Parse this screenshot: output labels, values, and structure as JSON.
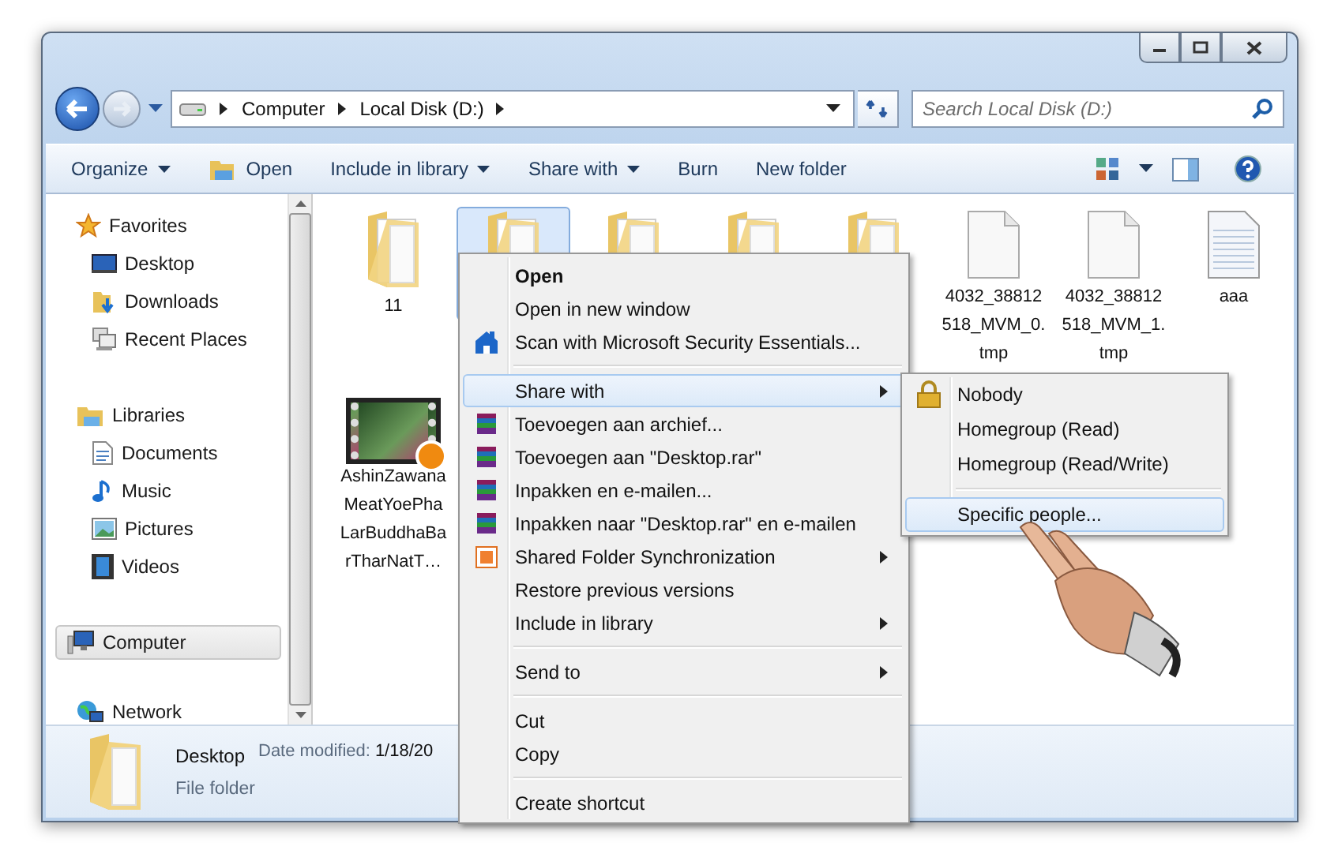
{
  "address": {
    "crumbs": [
      "Computer",
      "Local Disk (D:)"
    ]
  },
  "search": {
    "placeholder": "Search Local Disk (D:)"
  },
  "toolbar": {
    "buttons": [
      {
        "label": "Organize",
        "kind": "plain",
        "dropdown": true
      },
      {
        "label": "Open",
        "kind": "open",
        "dropdown": false
      },
      {
        "label": "Include in library",
        "kind": "plain",
        "dropdown": true
      },
      {
        "label": "Share with",
        "kind": "plain",
        "dropdown": true
      },
      {
        "label": "Burn",
        "kind": "plain",
        "dropdown": false
      },
      {
        "label": "New folder",
        "kind": "plain",
        "dropdown": false
      }
    ]
  },
  "navigation": [
    {
      "label": "Favorites",
      "kind": "favorites",
      "selected": false,
      "children": [
        {
          "label": "Desktop",
          "kind": "desktop",
          "selected": false
        },
        {
          "label": "Downloads",
          "kind": "downloads",
          "selected": false
        },
        {
          "label": "Recent Places",
          "kind": "recent",
          "selected": false
        }
      ]
    },
    {
      "label": "Libraries",
      "kind": "libraries",
      "selected": false,
      "children": [
        {
          "label": "Documents",
          "kind": "documents",
          "selected": false
        },
        {
          "label": "Music",
          "kind": "music",
          "selected": false
        },
        {
          "label": "Pictures",
          "kind": "pictures",
          "selected": false
        },
        {
          "label": "Videos",
          "kind": "videos",
          "selected": false
        }
      ]
    },
    {
      "label": "Computer",
      "kind": "computer",
      "selected": true
    },
    {
      "label": "Network",
      "kind": "network",
      "selected": false
    }
  ],
  "files": [
    {
      "kind": "folder",
      "selected": false,
      "name_lines": [
        "11"
      ]
    },
    {
      "kind": "folder",
      "selected": true
    },
    {
      "kind": "folder",
      "selected": false
    },
    {
      "kind": "folder",
      "selected": false
    },
    {
      "kind": "folder",
      "selected": false
    },
    {
      "kind": "file",
      "selected": false,
      "name_lines": [
        "4032_38812",
        "518_MVM_0.",
        "tmp"
      ]
    },
    {
      "kind": "file",
      "selected": false,
      "name_lines": [
        "4032_38812",
        "518_MVM_1.",
        "tmp"
      ]
    },
    {
      "kind": "text",
      "selected": false,
      "name_lines": [
        "aaa"
      ]
    },
    {
      "kind": "video",
      "selected": false,
      "name_lines": [
        "AshinZawana",
        "MeatYoePha",
        "LarBuddhaBa",
        "rTharNatT…"
      ]
    }
  ],
  "details": {
    "name": "Desktop",
    "type": "File folder",
    "date_label": "Date modified:",
    "date_value": "1/18/20"
  },
  "context_menu": {
    "items": [
      {
        "kind": "plain",
        "label": "Open",
        "default": true,
        "selected": false,
        "submenu": false
      },
      {
        "kind": "plain",
        "label": "Open in new window",
        "default": false,
        "selected": false,
        "submenu": false
      },
      {
        "kind": "security",
        "label": "Scan with Microsoft Security Essentials...",
        "default": false,
        "selected": false,
        "submenu": false
      },
      {
        "kind": "separator"
      },
      {
        "kind": "plain",
        "label": "Share with",
        "default": false,
        "selected": true,
        "submenu": true
      },
      {
        "kind": "archive",
        "label": "Toevoegen aan archief...",
        "default": false,
        "selected": false,
        "submenu": false
      },
      {
        "kind": "archive",
        "label": "Toevoegen aan \"Desktop.rar\"",
        "default": false,
        "selected": false,
        "submenu": false
      },
      {
        "kind": "archive",
        "label": "Inpakken en e-mailen...",
        "default": false,
        "selected": false,
        "submenu": false
      },
      {
        "kind": "archive",
        "label": "Inpakken naar \"Desktop.rar\" en e-mailen",
        "default": false,
        "selected": false,
        "submenu": false
      },
      {
        "kind": "sync",
        "label": "Shared Folder Synchronization",
        "default": false,
        "selected": false,
        "submenu": true
      },
      {
        "kind": "plain",
        "label": "Restore previous versions",
        "default": false,
        "selected": false,
        "submenu": false
      },
      {
        "kind": "plain",
        "label": "Include in library",
        "default": false,
        "selected": false,
        "submenu": true
      },
      {
        "kind": "separator"
      },
      {
        "kind": "plain",
        "label": "Send to",
        "default": false,
        "selected": false,
        "submenu": true
      },
      {
        "kind": "separator"
      },
      {
        "kind": "plain",
        "label": "Cut",
        "default": false,
        "selected": false,
        "submenu": false
      },
      {
        "kind": "plain",
        "label": "Copy",
        "default": false,
        "selected": false,
        "submenu": false
      },
      {
        "kind": "separator"
      },
      {
        "kind": "plain",
        "label": "Create shortcut",
        "default": false,
        "selected": false,
        "submenu": false
      }
    ]
  },
  "share_submenu": {
    "items": [
      {
        "kind": "lock",
        "label": "Nobody",
        "selected": false
      },
      {
        "kind": "plain",
        "label": "Homegroup (Read)",
        "selected": false
      },
      {
        "kind": "plain",
        "label": "Homegroup (Read/Write)",
        "selected": false
      },
      {
        "kind": "separator"
      },
      {
        "kind": "plain",
        "label": "Specific people...",
        "selected": true
      }
    ]
  }
}
